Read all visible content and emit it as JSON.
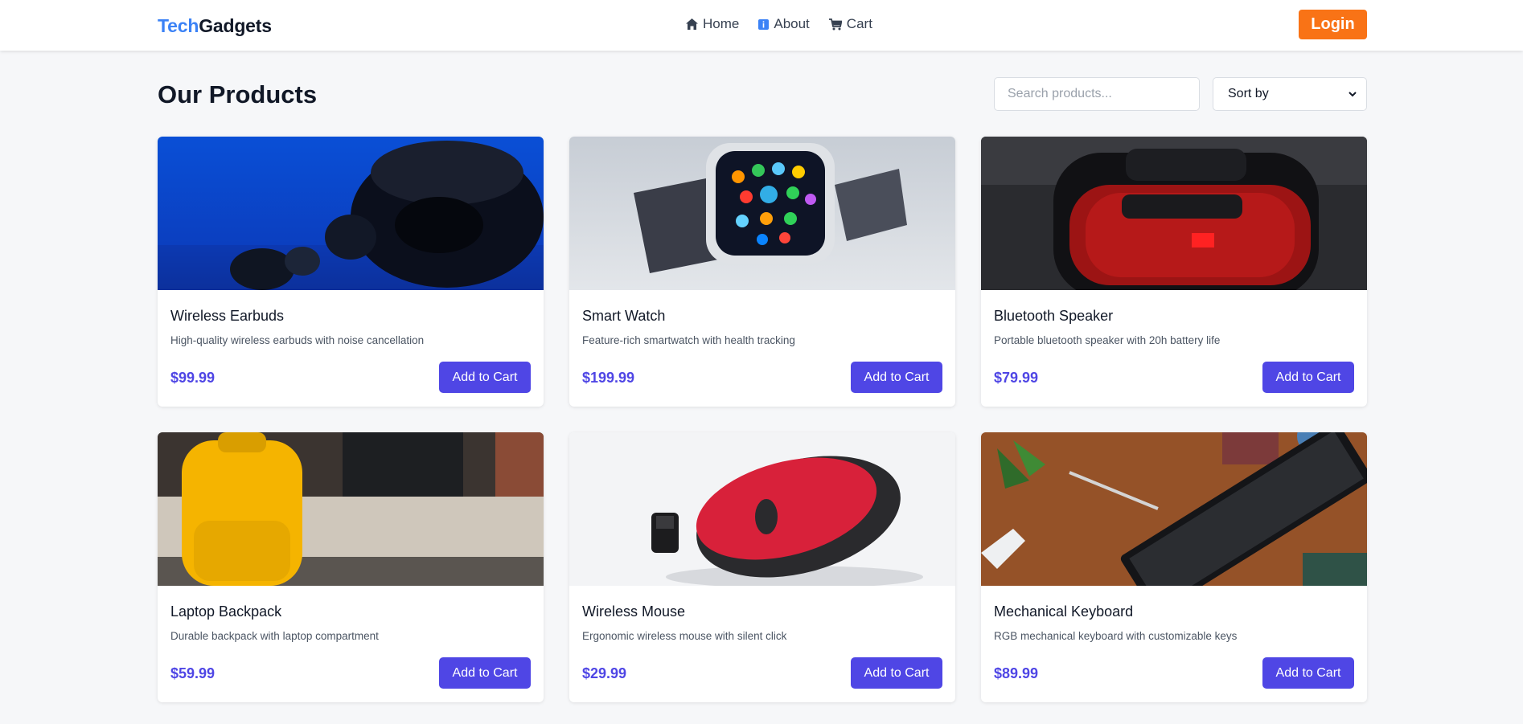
{
  "navbar": {
    "brand_part1": "Tech",
    "brand_part2": "Gadgets",
    "links": [
      {
        "label": "Home",
        "icon": "home-icon"
      },
      {
        "label": "About",
        "icon": "info-icon"
      },
      {
        "label": "Cart",
        "icon": "cart-icon"
      }
    ],
    "login_label": "Login"
  },
  "main": {
    "title": "Our Products",
    "search_placeholder": "Search products...",
    "sort_label": "Sort by"
  },
  "products": [
    {
      "name": "Wireless Earbuds",
      "description": "High-quality wireless earbuds with noise cancellation",
      "price": "$99.99",
      "button": "Add to Cart"
    },
    {
      "name": "Smart Watch",
      "description": "Feature-rich smartwatch with health tracking",
      "price": "$199.99",
      "button": "Add to Cart"
    },
    {
      "name": "Bluetooth Speaker",
      "description": "Portable bluetooth speaker with 20h battery life",
      "price": "$79.99",
      "button": "Add to Cart"
    },
    {
      "name": "Laptop Backpack",
      "description": "Durable backpack with laptop compartment",
      "price": "$59.99",
      "button": "Add to Cart"
    },
    {
      "name": "Wireless Mouse",
      "description": "Ergonomic wireless mouse with silent click",
      "price": "$29.99",
      "button": "Add to Cart"
    },
    {
      "name": "Mechanical Keyboard",
      "description": "RGB mechanical keyboard with customizable keys",
      "price": "$89.99",
      "button": "Add to Cart"
    }
  ],
  "colors": {
    "brand_accent": "#3b82f6",
    "login": "#f97316",
    "primary": "#4f46e5",
    "background": "#f6f7f9"
  }
}
